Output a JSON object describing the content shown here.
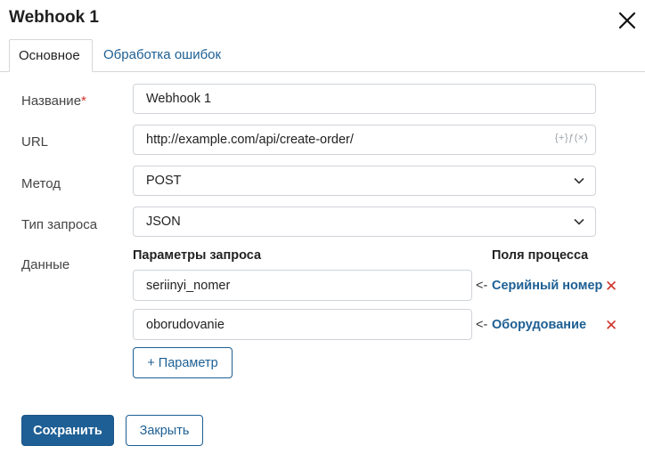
{
  "dialog": {
    "title": "Webhook 1",
    "close_icon": "close-icon"
  },
  "tabs": [
    {
      "label": "Основное",
      "active": true
    },
    {
      "label": "Обработка ошибок",
      "active": false
    }
  ],
  "form": {
    "name": {
      "label": "Название",
      "required_mark": "*",
      "value": "Webhook 1"
    },
    "url": {
      "label": "URL",
      "value": "http://example.com/api/create-order/",
      "icons": "{+}ƒ(×)"
    },
    "method": {
      "label": "Метод",
      "value": "POST"
    },
    "request_type": {
      "label": "Тип запроса",
      "value": "JSON"
    },
    "data": {
      "label": "Данные",
      "col_params": "Параметры запроса",
      "col_process": "Поля процесса",
      "arrow": "<-",
      "rows": [
        {
          "param": "seriinyi_nomer",
          "process_field": "Серийный номер"
        },
        {
          "param": "oborudovanie",
          "process_field": "Оборудование"
        }
      ],
      "add_param_label": "+ Параметр"
    }
  },
  "footer": {
    "save_label": "Сохранить",
    "close_label": "Закрыть"
  },
  "colors": {
    "accent": "#1e5f95",
    "link": "#1d5f93",
    "danger": "#d0342c"
  }
}
